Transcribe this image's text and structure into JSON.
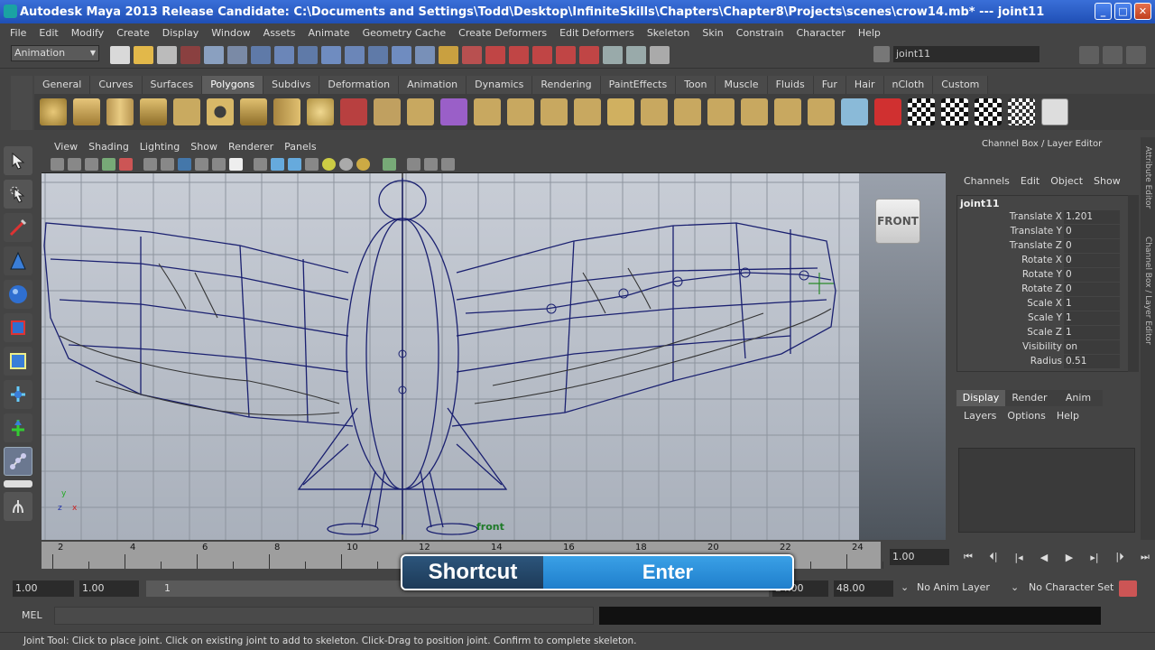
{
  "window": {
    "title": "Autodesk Maya 2013 Release Candidate: C:\\Documents and Settings\\Todd\\Desktop\\InfiniteSkills\\Chapters\\Chapter8\\Projects\\scenes\\crow14.mb*   ---   joint11",
    "minimize": "_",
    "maximize": "□",
    "close": "✕"
  },
  "menubar": [
    "File",
    "Edit",
    "Modify",
    "Create",
    "Display",
    "Window",
    "Assets",
    "Animate",
    "Geometry Cache",
    "Create Deformers",
    "Edit Deformers",
    "Skeleton",
    "Skin",
    "Constrain",
    "Character",
    "Help"
  ],
  "statusline": {
    "mode": "Animation",
    "object_field": "joint11"
  },
  "shelf_tabs": [
    "General",
    "Curves",
    "Surfaces",
    "Polygons",
    "Subdivs",
    "Deformation",
    "Animation",
    "Dynamics",
    "Rendering",
    "PaintEffects",
    "Toon",
    "Muscle",
    "Fluids",
    "Fur",
    "Hair",
    "nCloth",
    "Custom"
  ],
  "active_shelf_tab": "Polygons",
  "panel_menu": [
    "View",
    "Shading",
    "Lighting",
    "Show",
    "Renderer",
    "Panels"
  ],
  "viewport": {
    "view_cube": "FRONT",
    "camera_label": "front",
    "axis_y": "y",
    "axis_z": "z",
    "axis_x": "x"
  },
  "channel_box": {
    "title": "Channel Box / Layer Editor",
    "menu": [
      "Channels",
      "Edit",
      "Object",
      "Show"
    ],
    "object": "joint11",
    "attributes": [
      {
        "label": "Translate X",
        "value": "1.201"
      },
      {
        "label": "Translate Y",
        "value": "0"
      },
      {
        "label": "Translate Z",
        "value": "0"
      },
      {
        "label": "Rotate X",
        "value": "0"
      },
      {
        "label": "Rotate Y",
        "value": "0"
      },
      {
        "label": "Rotate Z",
        "value": "0"
      },
      {
        "label": "Scale X",
        "value": "1"
      },
      {
        "label": "Scale Y",
        "value": "1"
      },
      {
        "label": "Scale Z",
        "value": "1"
      },
      {
        "label": "Visibility",
        "value": "on"
      },
      {
        "label": "Radius",
        "value": "0.51"
      }
    ],
    "layer_tabs": [
      "Display",
      "Render",
      "Anim"
    ],
    "layer_menu": [
      "Layers",
      "Options",
      "Help"
    ]
  },
  "side_tabs": [
    "Attribute Editor",
    "Channel Box / Layer Editor"
  ],
  "timeslider": {
    "ticks": [
      "2",
      "4",
      "6",
      "8",
      "10",
      "12",
      "14",
      "16",
      "18",
      "20",
      "22",
      "24"
    ],
    "current_frame": "1.00"
  },
  "range": {
    "start": "1.00",
    "playback_start": "1.00",
    "slider_start": "1",
    "playback_end": "24.00",
    "end": "48.00",
    "anim_layer": "No Anim Layer",
    "character_set": "No Character Set"
  },
  "shortcut": {
    "label": "Shortcut",
    "key": "Enter"
  },
  "command_line": {
    "label": "MEL"
  },
  "help_line": "Joint Tool: Click to place joint. Click on existing joint to add to skeleton. Click-Drag to position joint. Confirm to complete skeleton."
}
